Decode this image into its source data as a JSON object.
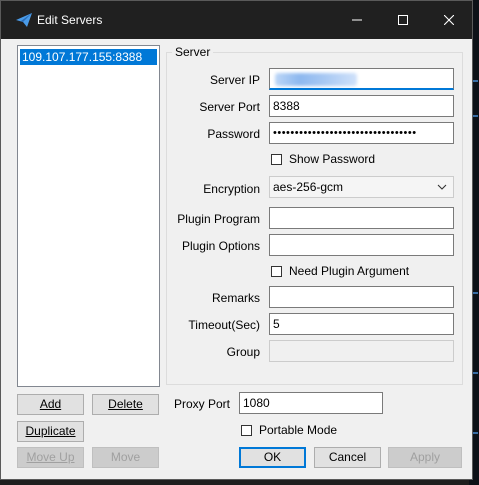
{
  "window": {
    "title": "Edit Servers",
    "controls": {
      "minimize": "—",
      "maximize": "☐",
      "close": "✕"
    }
  },
  "server_list": {
    "items": [
      {
        "label": "109.107.177.155:8388",
        "selected": true
      }
    ]
  },
  "list_buttons": {
    "add": "Add",
    "delete": "Delete",
    "duplicate": "Duplicate",
    "move_up": "Move Up",
    "move": "Move"
  },
  "server_group": {
    "title": "Server",
    "fields": {
      "server_ip": {
        "label": "Server IP",
        "value": ""
      },
      "server_port": {
        "label": "Server Port",
        "value": "8388"
      },
      "password": {
        "label": "Password",
        "value": "•••••••••••••••••••••••••••••••••"
      },
      "show_password": {
        "label": "Show Password",
        "checked": false
      },
      "encryption": {
        "label": "Encryption",
        "value": "aes-256-gcm"
      },
      "plugin_program": {
        "label": "Plugin Program",
        "value": ""
      },
      "plugin_options": {
        "label": "Plugin Options",
        "value": ""
      },
      "need_plugin_argument": {
        "label": "Need Plugin Argument",
        "checked": false
      },
      "remarks": {
        "label": "Remarks",
        "value": ""
      },
      "timeout": {
        "label": "Timeout(Sec)",
        "value": "5"
      },
      "group": {
        "label": "Group",
        "value": ""
      }
    }
  },
  "proxy": {
    "label": "Proxy Port",
    "value": "1080",
    "portable_mode": {
      "label": "Portable Mode",
      "checked": false
    }
  },
  "dialog_buttons": {
    "ok": "OK",
    "cancel": "Cancel",
    "apply": "Apply"
  },
  "colors": {
    "selection": "#0078d7",
    "titlebar": "#202020",
    "background": "#f0f0f0"
  }
}
